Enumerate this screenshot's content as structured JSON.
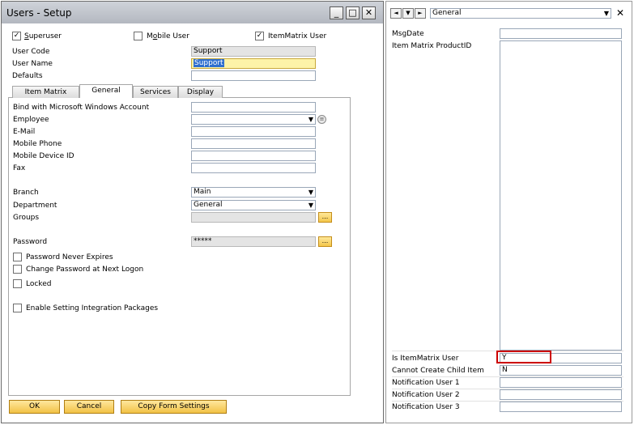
{
  "window": {
    "title": "Users - Setup",
    "controls": {
      "minimize": "_",
      "maximize": "□",
      "close": "✕"
    }
  },
  "header_checks": {
    "superuser": {
      "label": "Superuser",
      "mnemonic": "S",
      "rest": "uperuser",
      "checked": true
    },
    "mobile_user": {
      "label": "Mobile User",
      "pre": "M",
      "mnemonic": "o",
      "rest": "bile User",
      "checked": false
    },
    "itemmatrix_user": {
      "label": "ItemMatrix User",
      "checked": true
    }
  },
  "header_fields": {
    "user_code": {
      "label": "User Code",
      "value": "Support"
    },
    "user_name": {
      "label": "User Name",
      "value": "Support"
    },
    "defaults": {
      "label": "Defaults",
      "value": ""
    }
  },
  "tabs": [
    {
      "label": "Item Matrix",
      "active": false
    },
    {
      "label": "General",
      "active": true
    },
    {
      "label": "Services",
      "active": false
    },
    {
      "label": "Display",
      "active": false
    }
  ],
  "general": {
    "bind_windows": {
      "label": "Bind with Microsoft Windows Account",
      "value": ""
    },
    "employee": {
      "label": "Employee",
      "value": ""
    },
    "email": {
      "label": "E-Mail",
      "value": ""
    },
    "mobile_phone": {
      "label": "Mobile Phone",
      "value": ""
    },
    "mobile_device_id": {
      "label": "Mobile Device ID",
      "value": ""
    },
    "fax": {
      "label": "Fax",
      "value": ""
    },
    "branch": {
      "label": "Branch",
      "value": "Main"
    },
    "department": {
      "label": "Department",
      "value": "General"
    },
    "groups": {
      "label": "Groups",
      "value": ""
    },
    "password": {
      "label": "Password",
      "value": "*****"
    },
    "ellipsis": "...",
    "checks": {
      "password_never_expires": {
        "label": "Password Never Expires",
        "checked": false
      },
      "change_password": {
        "label": "Change Password at Next Logon",
        "checked": false
      },
      "locked": {
        "label": "Locked",
        "checked": false
      },
      "enable_integration": {
        "label": "Enable Setting Integration Packages",
        "checked": false
      }
    }
  },
  "buttons": {
    "ok": "OK",
    "cancel": "Cancel",
    "copy_form_settings": "Copy Form Settings"
  },
  "udf_panel": {
    "nav": {
      "prev": "◄",
      "next": "►"
    },
    "category": "General",
    "fields": {
      "msg_date": {
        "label": "MsgDate",
        "value": ""
      },
      "item_matrix_product_id": {
        "label": "Item Matrix ProductID",
        "value": ""
      },
      "is_itemmatrix_user": {
        "label": "Is ItemMatrix User",
        "value": "Y"
      },
      "cannot_create_child": {
        "label": "Cannot Create Child Item",
        "value": "N"
      },
      "notification_user_1": {
        "label": "Notification User 1",
        "value": ""
      },
      "notification_user_2": {
        "label": "Notification User 2",
        "value": ""
      },
      "notification_user_3": {
        "label": "Notification User 3",
        "value": ""
      }
    }
  },
  "colors": {
    "title_bar": "#b9bec6",
    "highlight": "#cc0000",
    "button_gold": "#f2c245",
    "selection": "#2f6fcf"
  }
}
